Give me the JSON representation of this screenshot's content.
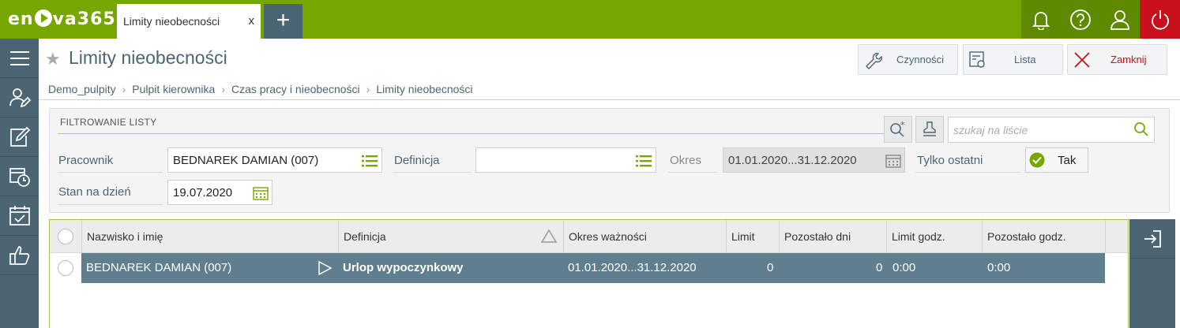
{
  "app": {
    "logo": "enova365",
    "logo_pre": "en",
    "logo_post": "va365"
  },
  "tabs": [
    {
      "label": "Limity nieobecności",
      "close": "x"
    }
  ],
  "topbar": {
    "add_tab": "+",
    "icons": [
      "bell-icon",
      "help-icon",
      "user-icon",
      "power-icon"
    ]
  },
  "sidebar": {
    "items": [
      "menu-icon",
      "user-edit-icon",
      "edit-icon",
      "calendar-clock-icon",
      "calendar-check-icon",
      "thumbs-up-icon"
    ]
  },
  "page": {
    "title": "Limity nieobecności"
  },
  "actions": {
    "czynnosci": "Czynności",
    "lista": "Lista",
    "zamknij": "Zamknij"
  },
  "breadcrumb": [
    "Demo_pulpity",
    "Pulpit kierownika",
    "Czas pracy i nieobecności",
    "Limity nieobecności"
  ],
  "filter": {
    "title": "FILTROWANIE LISTY",
    "search_placeholder": "szukaj na liście",
    "pracownik_label": "Pracownik",
    "pracownik_value": "BEDNAREK DAMIAN (007)",
    "definicja_label": "Definicja",
    "definicja_value": "",
    "okres_label": "Okres",
    "okres_value": "01.01.2020...31.12.2020",
    "tylko_label": "Tylko ostatni",
    "tylko_value": "Tak",
    "stan_label": "Stan na dzień",
    "stan_value": "19.07.2020"
  },
  "grid": {
    "columns": [
      "Nazwisko i imię",
      "Definicja",
      "Okres ważności",
      "Limit",
      "Pozostało dni",
      "Limit godz.",
      "Pozostało godz."
    ],
    "rows": [
      {
        "name": "BEDNAREK DAMIAN (007)",
        "definicja": "Urlop wypoczynkowy",
        "okres": "01.01.2020...31.12.2020",
        "limit": "0",
        "pozostalo_dni": "0",
        "limit_godz": "0:00",
        "pozostalo_godz": "0:00"
      }
    ]
  },
  "colors": {
    "brand": "#76a700",
    "slate": "#4b6572",
    "selected_row": "#5f7f8e",
    "close_red": "#c8111a"
  }
}
